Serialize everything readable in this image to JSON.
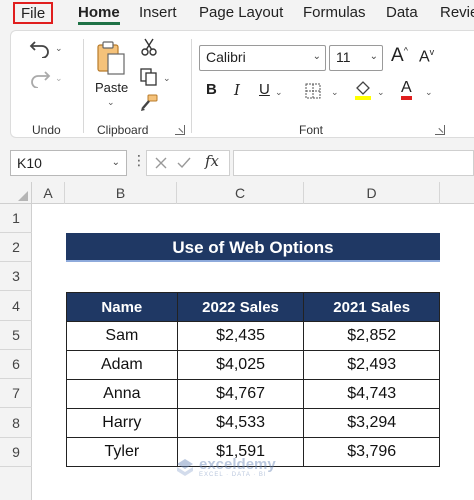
{
  "menu": {
    "tabs": [
      {
        "label": "File"
      },
      {
        "label": "Home"
      },
      {
        "label": "Insert"
      },
      {
        "label": "Page Layout"
      },
      {
        "label": "Formulas"
      },
      {
        "label": "Data"
      },
      {
        "label": "Revie"
      }
    ],
    "highlight_color": "#e01e1e",
    "active_tab_color": "#1e7145"
  },
  "ribbon": {
    "undo_group_label": "Undo",
    "clipboard_group_label": "Clipboard",
    "font_group_label": "Font",
    "paste_label": "Paste",
    "font_name": "Calibri",
    "font_size": "11",
    "bold_label": "B",
    "italic_label": "I",
    "underline_label": "U",
    "grow_font_label": "A",
    "shrink_font_label": "A",
    "font_color_label": "A",
    "highlight_color": "#ffff00",
    "font_color": "#e01e1e",
    "icons": [
      "undo-icon",
      "redo-icon",
      "paste-icon",
      "cut-icon",
      "copy-icon",
      "format-painter-icon",
      "borders-icon",
      "fill-color-icon",
      "font-color-icon"
    ]
  },
  "formula_bar": {
    "name_box": "K10",
    "fx_label": "fx",
    "formula": ""
  },
  "grid": {
    "columns": [
      "A",
      "B",
      "C",
      "D"
    ],
    "rows": [
      "1",
      "2",
      "3",
      "4",
      "5",
      "6",
      "7",
      "8",
      "9"
    ]
  },
  "sheet": {
    "title": "Use of Web Options",
    "title_bg": "#1f3864",
    "headers": [
      "Name",
      "2022 Sales",
      "2021 Sales"
    ],
    "rows": [
      [
        "Sam",
        "$2,435",
        "$2,852"
      ],
      [
        "Adam",
        "$4,025",
        "$2,493"
      ],
      [
        "Anna",
        "$4,767",
        "$4,743"
      ],
      [
        "Harry",
        "$4,533",
        "$3,294"
      ],
      [
        "Tyler",
        "$1,591",
        "$3,796"
      ]
    ]
  },
  "watermark": {
    "brand": "exceldemy",
    "tagline": "EXCEL · DATA · BI"
  }
}
